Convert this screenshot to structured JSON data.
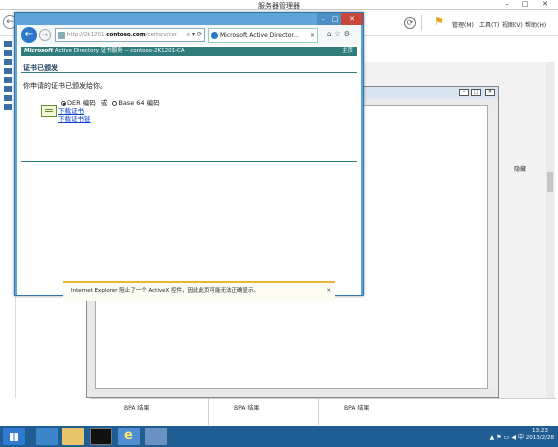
{
  "server_manager": {
    "title": "服务器管理器",
    "menu": [
      "管理(M)",
      "工具(T)",
      "视图(V)",
      "帮助(H)"
    ],
    "hide_label": "隐藏",
    "bpa_labels": [
      "BPA 结果",
      "BPA 结果",
      "BPA 结果"
    ]
  },
  "ie": {
    "address": {
      "prefix": "http://2k1201.",
      "domain": "contoso.com",
      "suffix": "/certsrv/cer"
    },
    "tab_title": "Microsoft Active Director...",
    "page": {
      "header_brand": "Microsoft",
      "header_text": " Active Directory 证书服务  --  contoso-2K1201-CA",
      "home_link": "主页",
      "section_title": "证书已颁发",
      "message": "你申请的证书已颁发给你。",
      "der_label": "DER 编码",
      "or_label": "或",
      "base64_label": "Base 64 编码",
      "download_cert": "下载证书",
      "download_chain": "下载证书链"
    },
    "infobar": "Internet Explorer 阻止了一个 ActiveX 控件，因此此页可能无法正确显示。"
  },
  "taskbar": {
    "time": "13:23",
    "date": "2013/2/28"
  },
  "colors": {
    "ie_frame": "#5fa4d6",
    "header_teal": "#2f7c7c",
    "link_blue": "#0b3fcf",
    "taskbar": "#1f5d93",
    "close_red": "#c7483a"
  }
}
